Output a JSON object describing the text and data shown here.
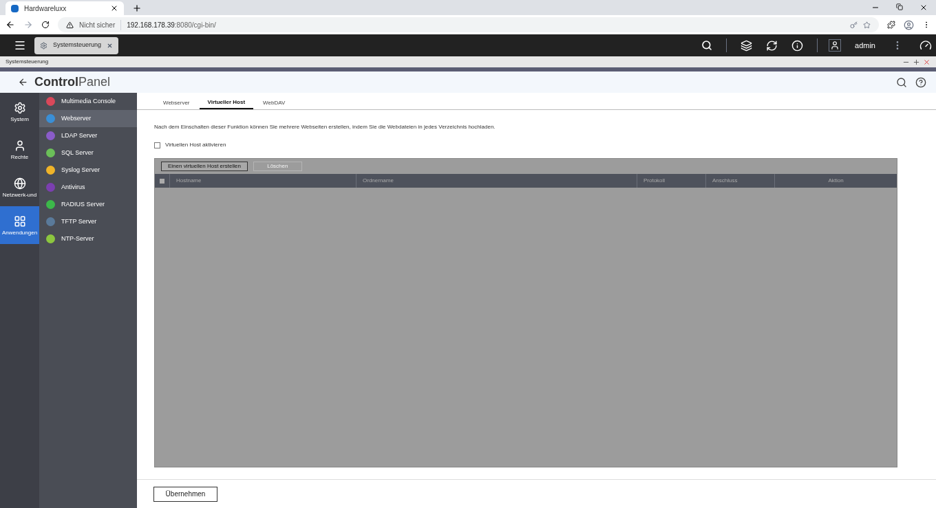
{
  "browser": {
    "tab_title": "Hardwareluxx",
    "security": "Nicht sicher",
    "url_host": "192.168.178.39",
    "url_rest": ":8080/cgi-bin/"
  },
  "app_bar": {
    "open_app": "Systemsteuerung",
    "user": "admin"
  },
  "window": {
    "title": "Systemsteuerung"
  },
  "header": {
    "title_bold": "Control",
    "title_light": "Panel"
  },
  "rail": [
    {
      "label": "System",
      "selected": false
    },
    {
      "label": "Rechte",
      "selected": false
    },
    {
      "label": "Netzwerk-und",
      "selected": false
    },
    {
      "label": "Anwendungen",
      "selected": true
    }
  ],
  "menu": [
    {
      "label": "Multimedia Console",
      "color": "#d9485a",
      "selected": false
    },
    {
      "label": "Webserver",
      "color": "#3a8fd6",
      "selected": true
    },
    {
      "label": "LDAP Server",
      "color": "#8a5cc9",
      "selected": false
    },
    {
      "label": "SQL Server",
      "color": "#6bbf59",
      "selected": false
    },
    {
      "label": "Syslog Server",
      "color": "#f0b429",
      "selected": false
    },
    {
      "label": "Antivirus",
      "color": "#7b3fb0",
      "selected": false
    },
    {
      "label": "RADIUS Server",
      "color": "#3cb84a",
      "selected": false
    },
    {
      "label": "TFTP Server",
      "color": "#5a7a9a",
      "selected": false
    },
    {
      "label": "NTP-Server",
      "color": "#8cc63f",
      "selected": false
    }
  ],
  "tabs": [
    {
      "label": "Webserver",
      "selected": false
    },
    {
      "label": "Virtueller Host",
      "selected": true
    },
    {
      "label": "WebDAV",
      "selected": false
    }
  ],
  "description": "Nach dem Einschalten dieser Funktion können Sie mehrere Webseiten erstellen, indem Sie die Webdateien in jedes Verzeichnis hochladen.",
  "enable_checkbox": {
    "label": "Virtuellen Host aktivieren",
    "checked": false
  },
  "toolbar": [
    {
      "label": "Einen virtuellen Host erstellen",
      "disabled": false
    },
    {
      "label": "Löschen",
      "disabled": true
    }
  ],
  "table": {
    "select_all": false,
    "columns": [
      {
        "label": "Hostname"
      },
      {
        "label": "Ordnername"
      },
      {
        "label": "Protokoll"
      },
      {
        "label": "Anschluss"
      },
      {
        "label": "Aktion"
      }
    ]
  },
  "apply_button": "Übernehmen"
}
